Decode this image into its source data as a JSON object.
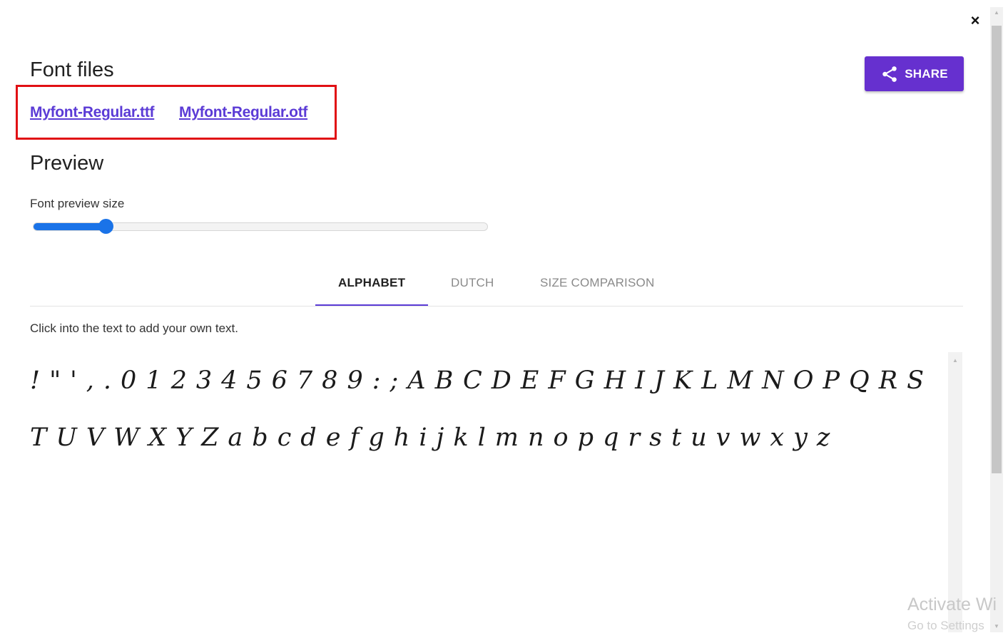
{
  "dialog": {
    "close_label": "×"
  },
  "font_files": {
    "title": "Font files",
    "links": [
      "Myfont-Regular.ttf",
      "Myfont-Regular.otf"
    ]
  },
  "share": {
    "label": "SHARE",
    "icon": "share-icon",
    "color": "#6630cf"
  },
  "preview": {
    "title": "Preview",
    "slider_label": "Font preview size",
    "slider_value_fraction": 0.16
  },
  "tabs": [
    {
      "label": "ALPHABET",
      "active": true
    },
    {
      "label": "DUTCH",
      "active": false
    },
    {
      "label": "SIZE COMPARISON",
      "active": false
    }
  ],
  "hint": "Click into the text to add your own text.",
  "sample_text": "!\"',.0123456789:;ABCDEFGHIJKLMNOPQRSTUVWXYZabcdefghijklmnopqrstuvwxyz",
  "watermark": {
    "title": "Activate Wi",
    "subtitle": "Go to Settings"
  },
  "colors": {
    "accent": "#5b3bd6",
    "slider": "#1a73e8",
    "highlight_box": "#e10f14"
  }
}
